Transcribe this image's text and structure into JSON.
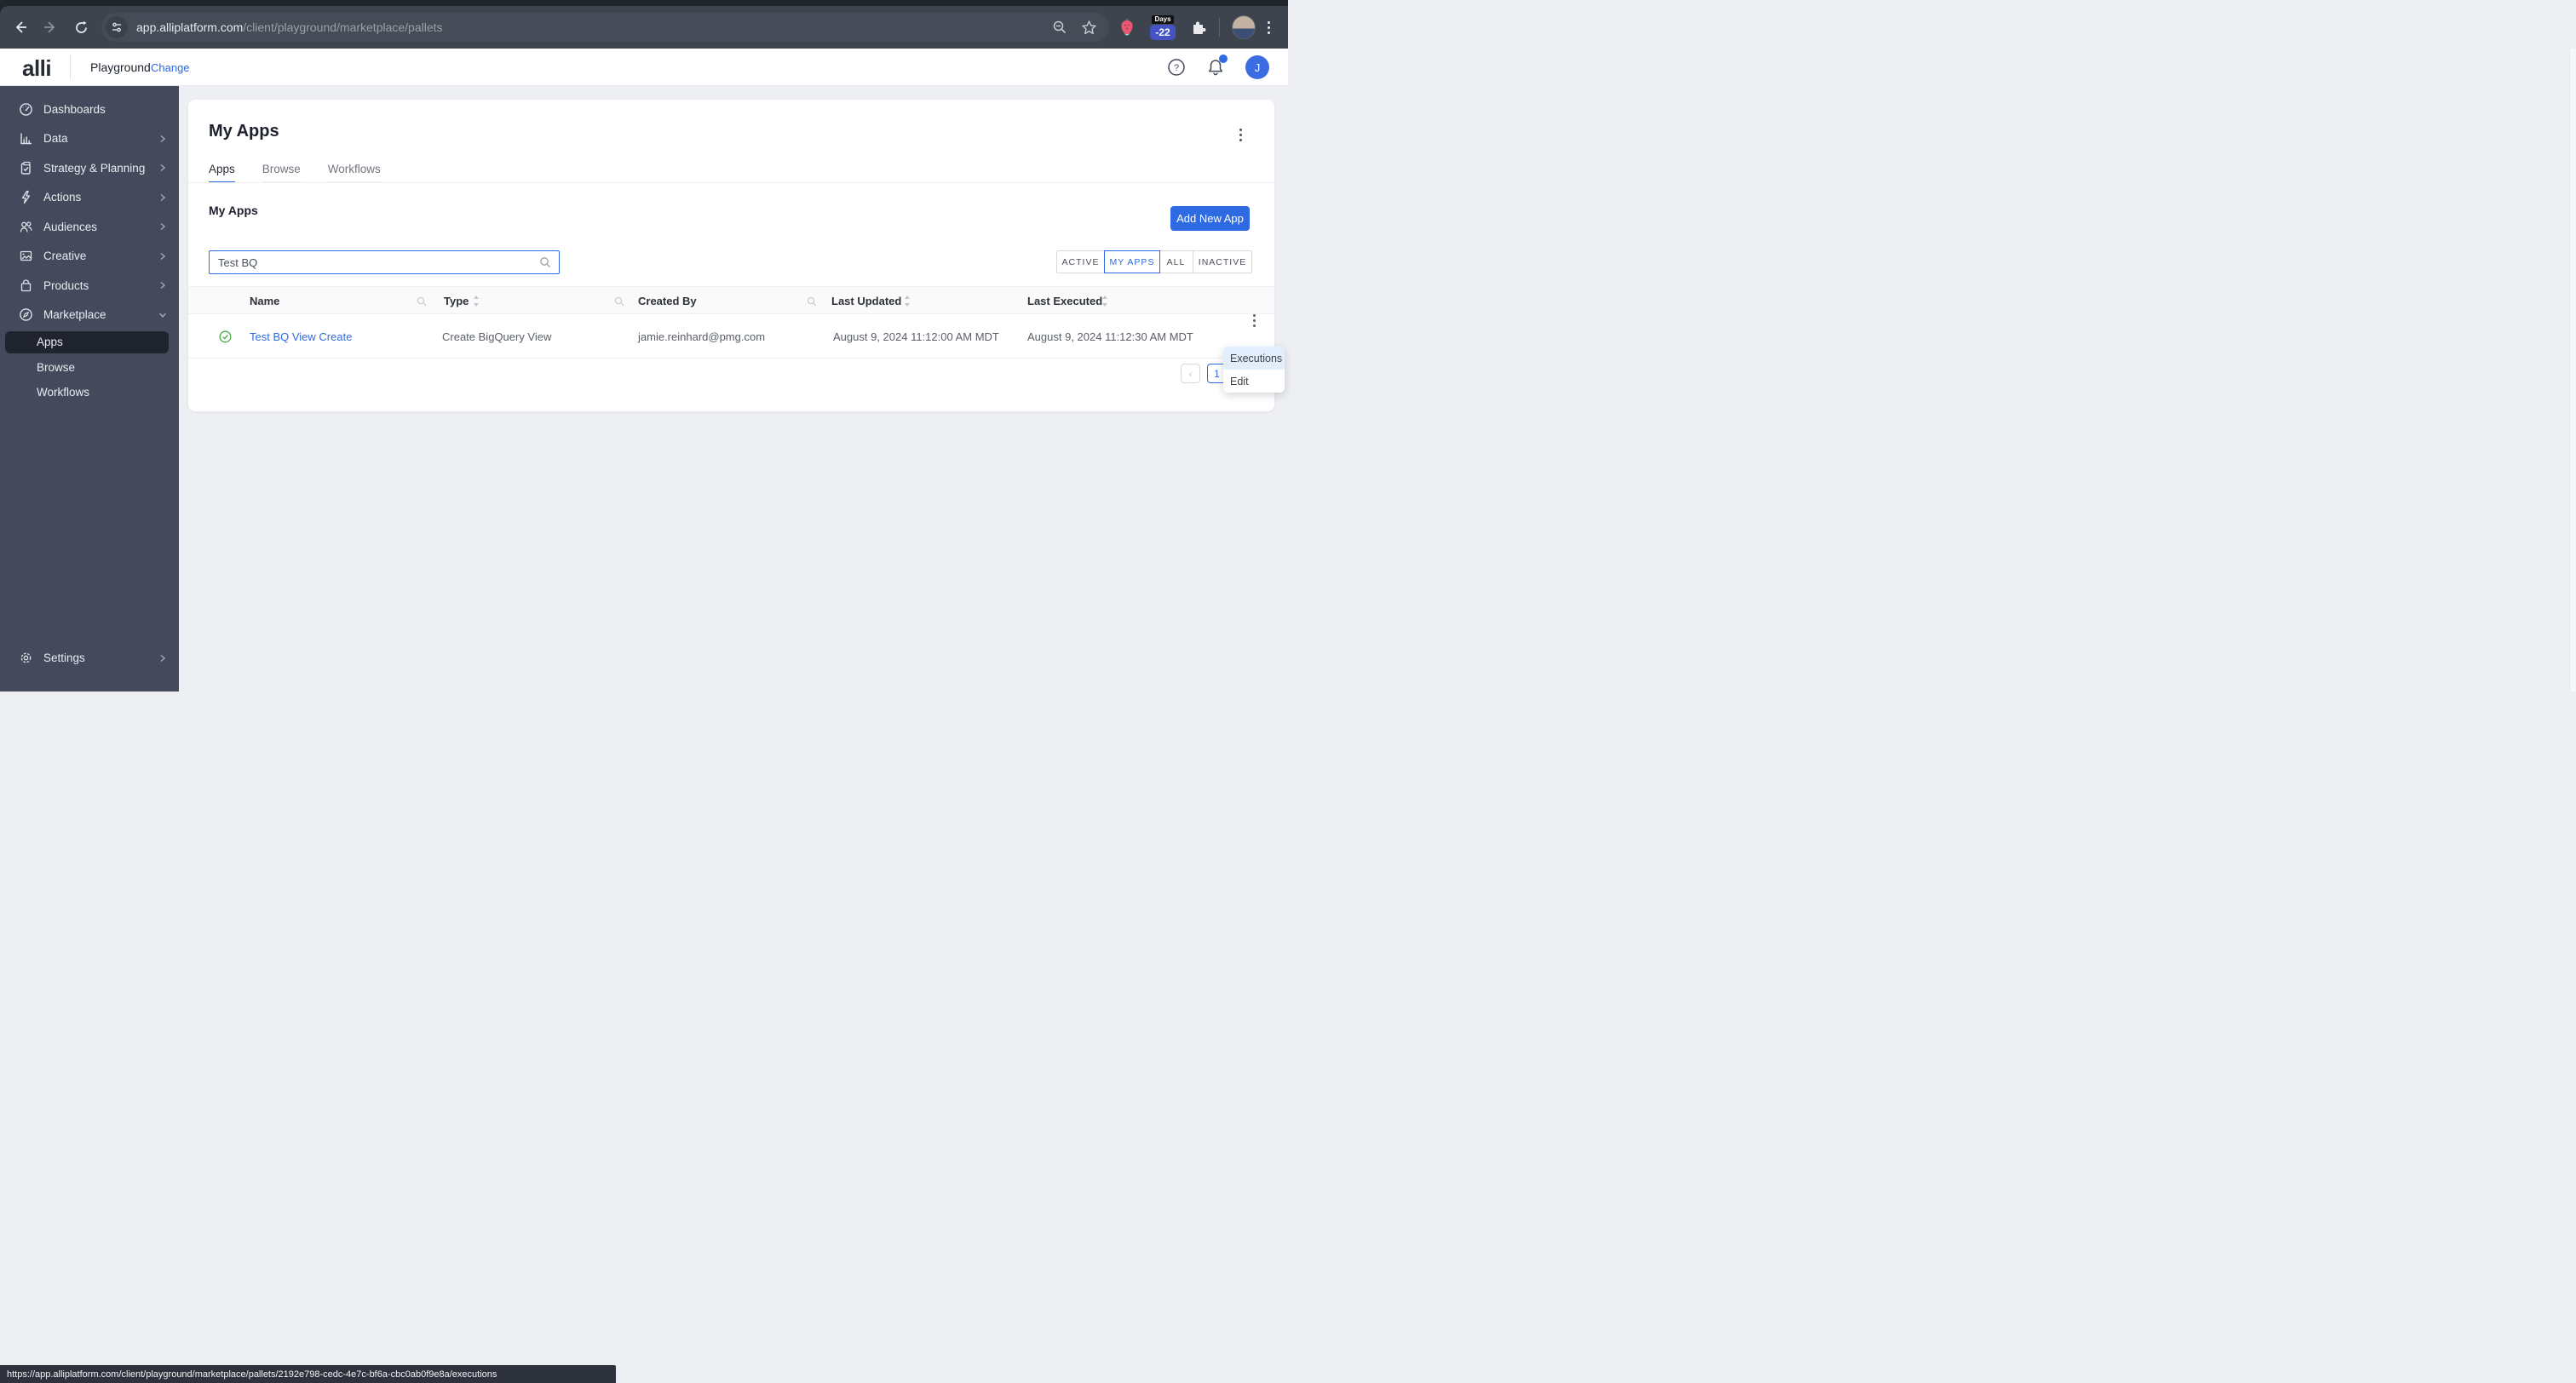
{
  "browser": {
    "url_host": "app.alliplatform.com",
    "url_path": "/client/playground/marketplace/pallets",
    "days_extension": {
      "label": "Days",
      "value": "-22"
    }
  },
  "header": {
    "logo": "alli",
    "workspace": "Playground",
    "change_link": "Change",
    "avatar_initial": "J"
  },
  "sidebar": {
    "items": [
      {
        "label": "Dashboards",
        "icon": "gauge-icon"
      },
      {
        "label": "Data",
        "icon": "bar-chart-icon"
      },
      {
        "label": "Strategy & Planning",
        "icon": "clipboard-icon"
      },
      {
        "label": "Actions",
        "icon": "lightning-icon"
      },
      {
        "label": "Audiences",
        "icon": "people-icon"
      },
      {
        "label": "Creative",
        "icon": "image-icon"
      },
      {
        "label": "Products",
        "icon": "bag-icon"
      },
      {
        "label": "Marketplace",
        "icon": "compass-icon"
      }
    ],
    "sub_items": [
      {
        "label": "Apps",
        "active": true
      },
      {
        "label": "Browse"
      },
      {
        "label": "Workflows"
      }
    ],
    "settings_label": "Settings"
  },
  "main": {
    "page_title": "My Apps",
    "tabs": [
      {
        "label": "Apps",
        "active": true
      },
      {
        "label": "Browse"
      },
      {
        "label": "Workflows"
      }
    ],
    "section_title": "My Apps",
    "add_button_label": "Add New App",
    "search_value": "Test BQ",
    "filters": [
      {
        "label": "ACTIVE"
      },
      {
        "label": "MY APPS",
        "active": true
      },
      {
        "label": "ALL"
      },
      {
        "label": "INACTIVE"
      }
    ],
    "table": {
      "columns": [
        "Name",
        "Type",
        "Created By",
        "Last Updated",
        "Last Executed"
      ],
      "rows": [
        {
          "status": "active",
          "name": "Test BQ View Create",
          "type": "Create BigQuery View",
          "created_by": "jamie.reinhard@pmg.com",
          "last_updated": "August 9, 2024 11:12:00 AM MDT",
          "last_executed": "August 9, 2024 11:12:30 AM MDT"
        }
      ]
    },
    "pagination": {
      "prev": "‹",
      "page": "1"
    },
    "context_menu": {
      "items": [
        {
          "label": "Executions",
          "highlighted": true
        },
        {
          "label": "Edit"
        }
      ]
    }
  },
  "status_bar": {
    "url": "https://app.alliplatform.com/client/playground/marketplace/pallets/2192e798-cedc-4e7c-bf6a-cbc0ab0f9e8a/executions"
  },
  "colors": {
    "accent_blue": "#2e6ae1",
    "link_blue": "#2f6bdf",
    "sidebar_bg": "#444a5b",
    "sidebar_active_bg": "#20242f",
    "status_green": "#49a94c",
    "menu_highlight": "#e3eefc"
  }
}
